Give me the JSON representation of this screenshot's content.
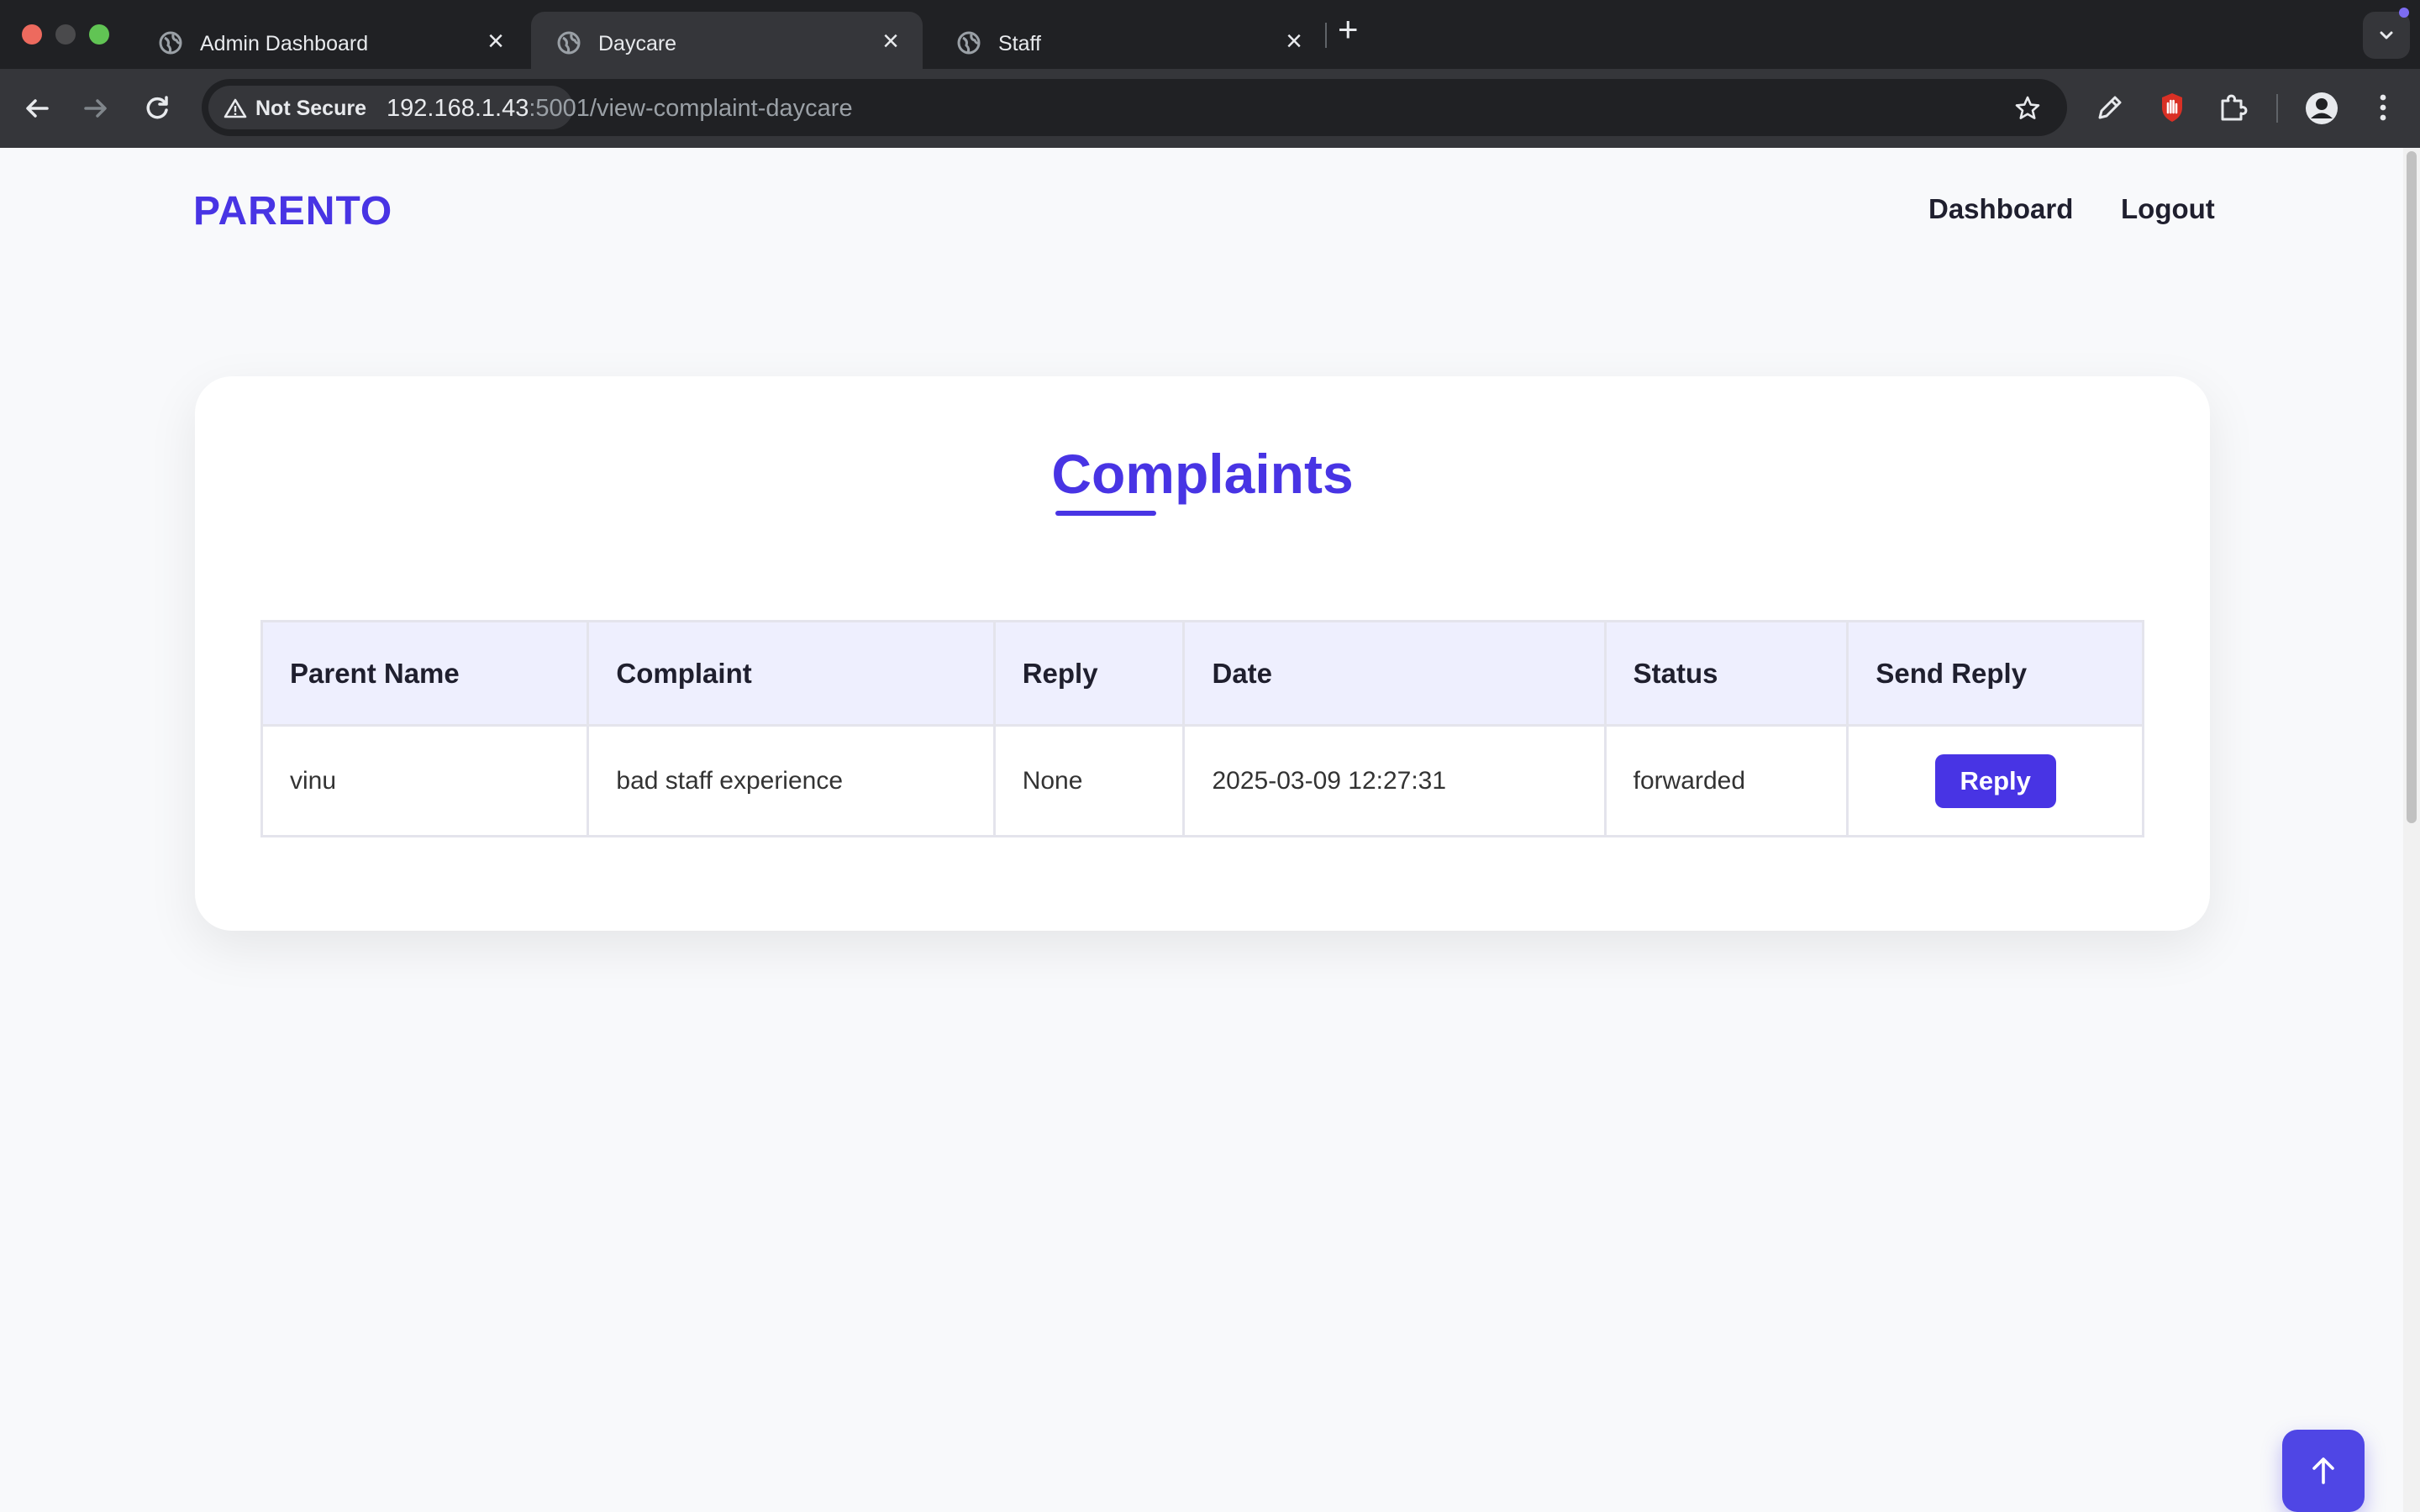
{
  "browser": {
    "tabs": [
      {
        "title": "Admin Dashboard",
        "active": false
      },
      {
        "title": "Daycare",
        "active": true
      },
      {
        "title": "Staff",
        "active": false
      }
    ],
    "security_label": "Not Secure",
    "url_host": "192.168.1.43",
    "url_rest": ":5001/view-complaint-daycare"
  },
  "nav": {
    "brand": "PARENTO",
    "links": [
      "Dashboard",
      "Logout"
    ]
  },
  "main": {
    "title": "Complaints",
    "table": {
      "columns": [
        "Parent Name",
        "Complaint",
        "Reply",
        "Date",
        "Status",
        "Send Reply"
      ],
      "rows": [
        {
          "parent_name": "vinu",
          "complaint": "bad staff experience",
          "reply": "None",
          "date": "2025-03-09 12:27:31",
          "status": "forwarded",
          "action_label": "Reply"
        }
      ]
    }
  },
  "colors": {
    "accent": "#4834e4",
    "header_bg": "#eeeffe",
    "page_bg": "#f8f9fb"
  },
  "icons": [
    "globe-icon",
    "close-icon",
    "plus-icon",
    "chevron-down-icon",
    "back-arrow-icon",
    "forward-arrow-icon",
    "reload-icon",
    "warning-icon",
    "star-icon",
    "pen-icon",
    "stop-hand-icon",
    "puzzle-icon",
    "profile-icon",
    "kebab-menu-icon",
    "arrow-up-icon"
  ]
}
